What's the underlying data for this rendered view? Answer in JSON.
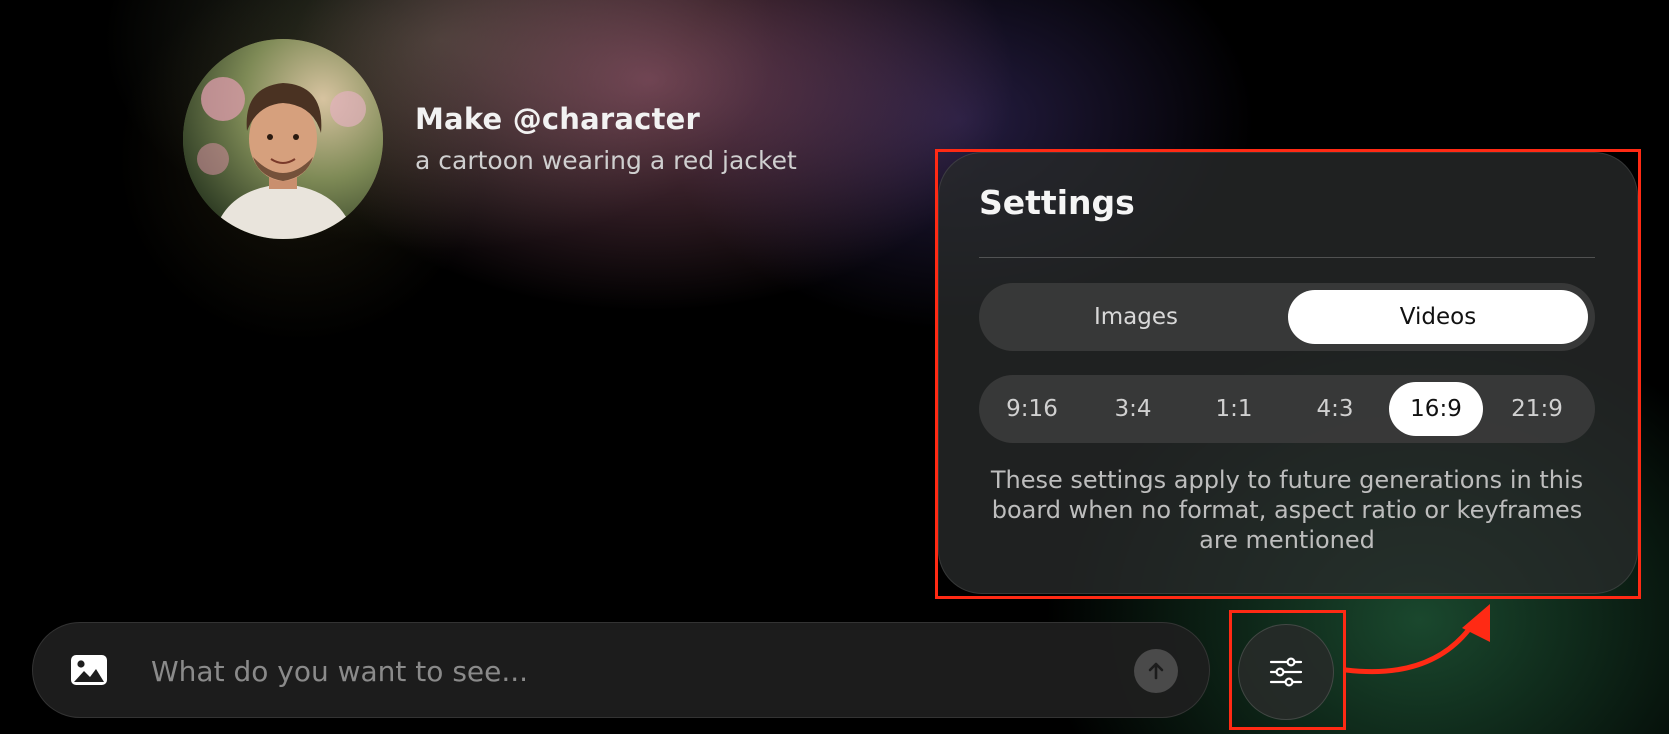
{
  "header": {
    "title": "Make @character",
    "subtitle": "a cartoon wearing a red jacket",
    "avatar_icon": "person-avatar"
  },
  "settings": {
    "title": "Settings",
    "format_options": [
      {
        "label": "Images",
        "selected": false
      },
      {
        "label": "Videos",
        "selected": true
      }
    ],
    "aspect_ratios": [
      {
        "label": "9:16",
        "selected": false
      },
      {
        "label": "3:4",
        "selected": false
      },
      {
        "label": "1:1",
        "selected": false
      },
      {
        "label": "4:3",
        "selected": false
      },
      {
        "label": "16:9",
        "selected": true
      },
      {
        "label": "21:9",
        "selected": false
      }
    ],
    "note": "These settings apply to future generations in this board when no format, aspect ratio or keyframes are mentioned"
  },
  "prompt_bar": {
    "placeholder": "What do you want to see...",
    "value": "",
    "image_icon": "image-icon",
    "send_icon": "arrow-up-icon"
  },
  "settings_button": {
    "icon": "sliders-icon"
  },
  "colors": {
    "annotation_red": "#ff2a14",
    "selected_bg": "#ffffff",
    "panel_bg": "#282a2a"
  }
}
